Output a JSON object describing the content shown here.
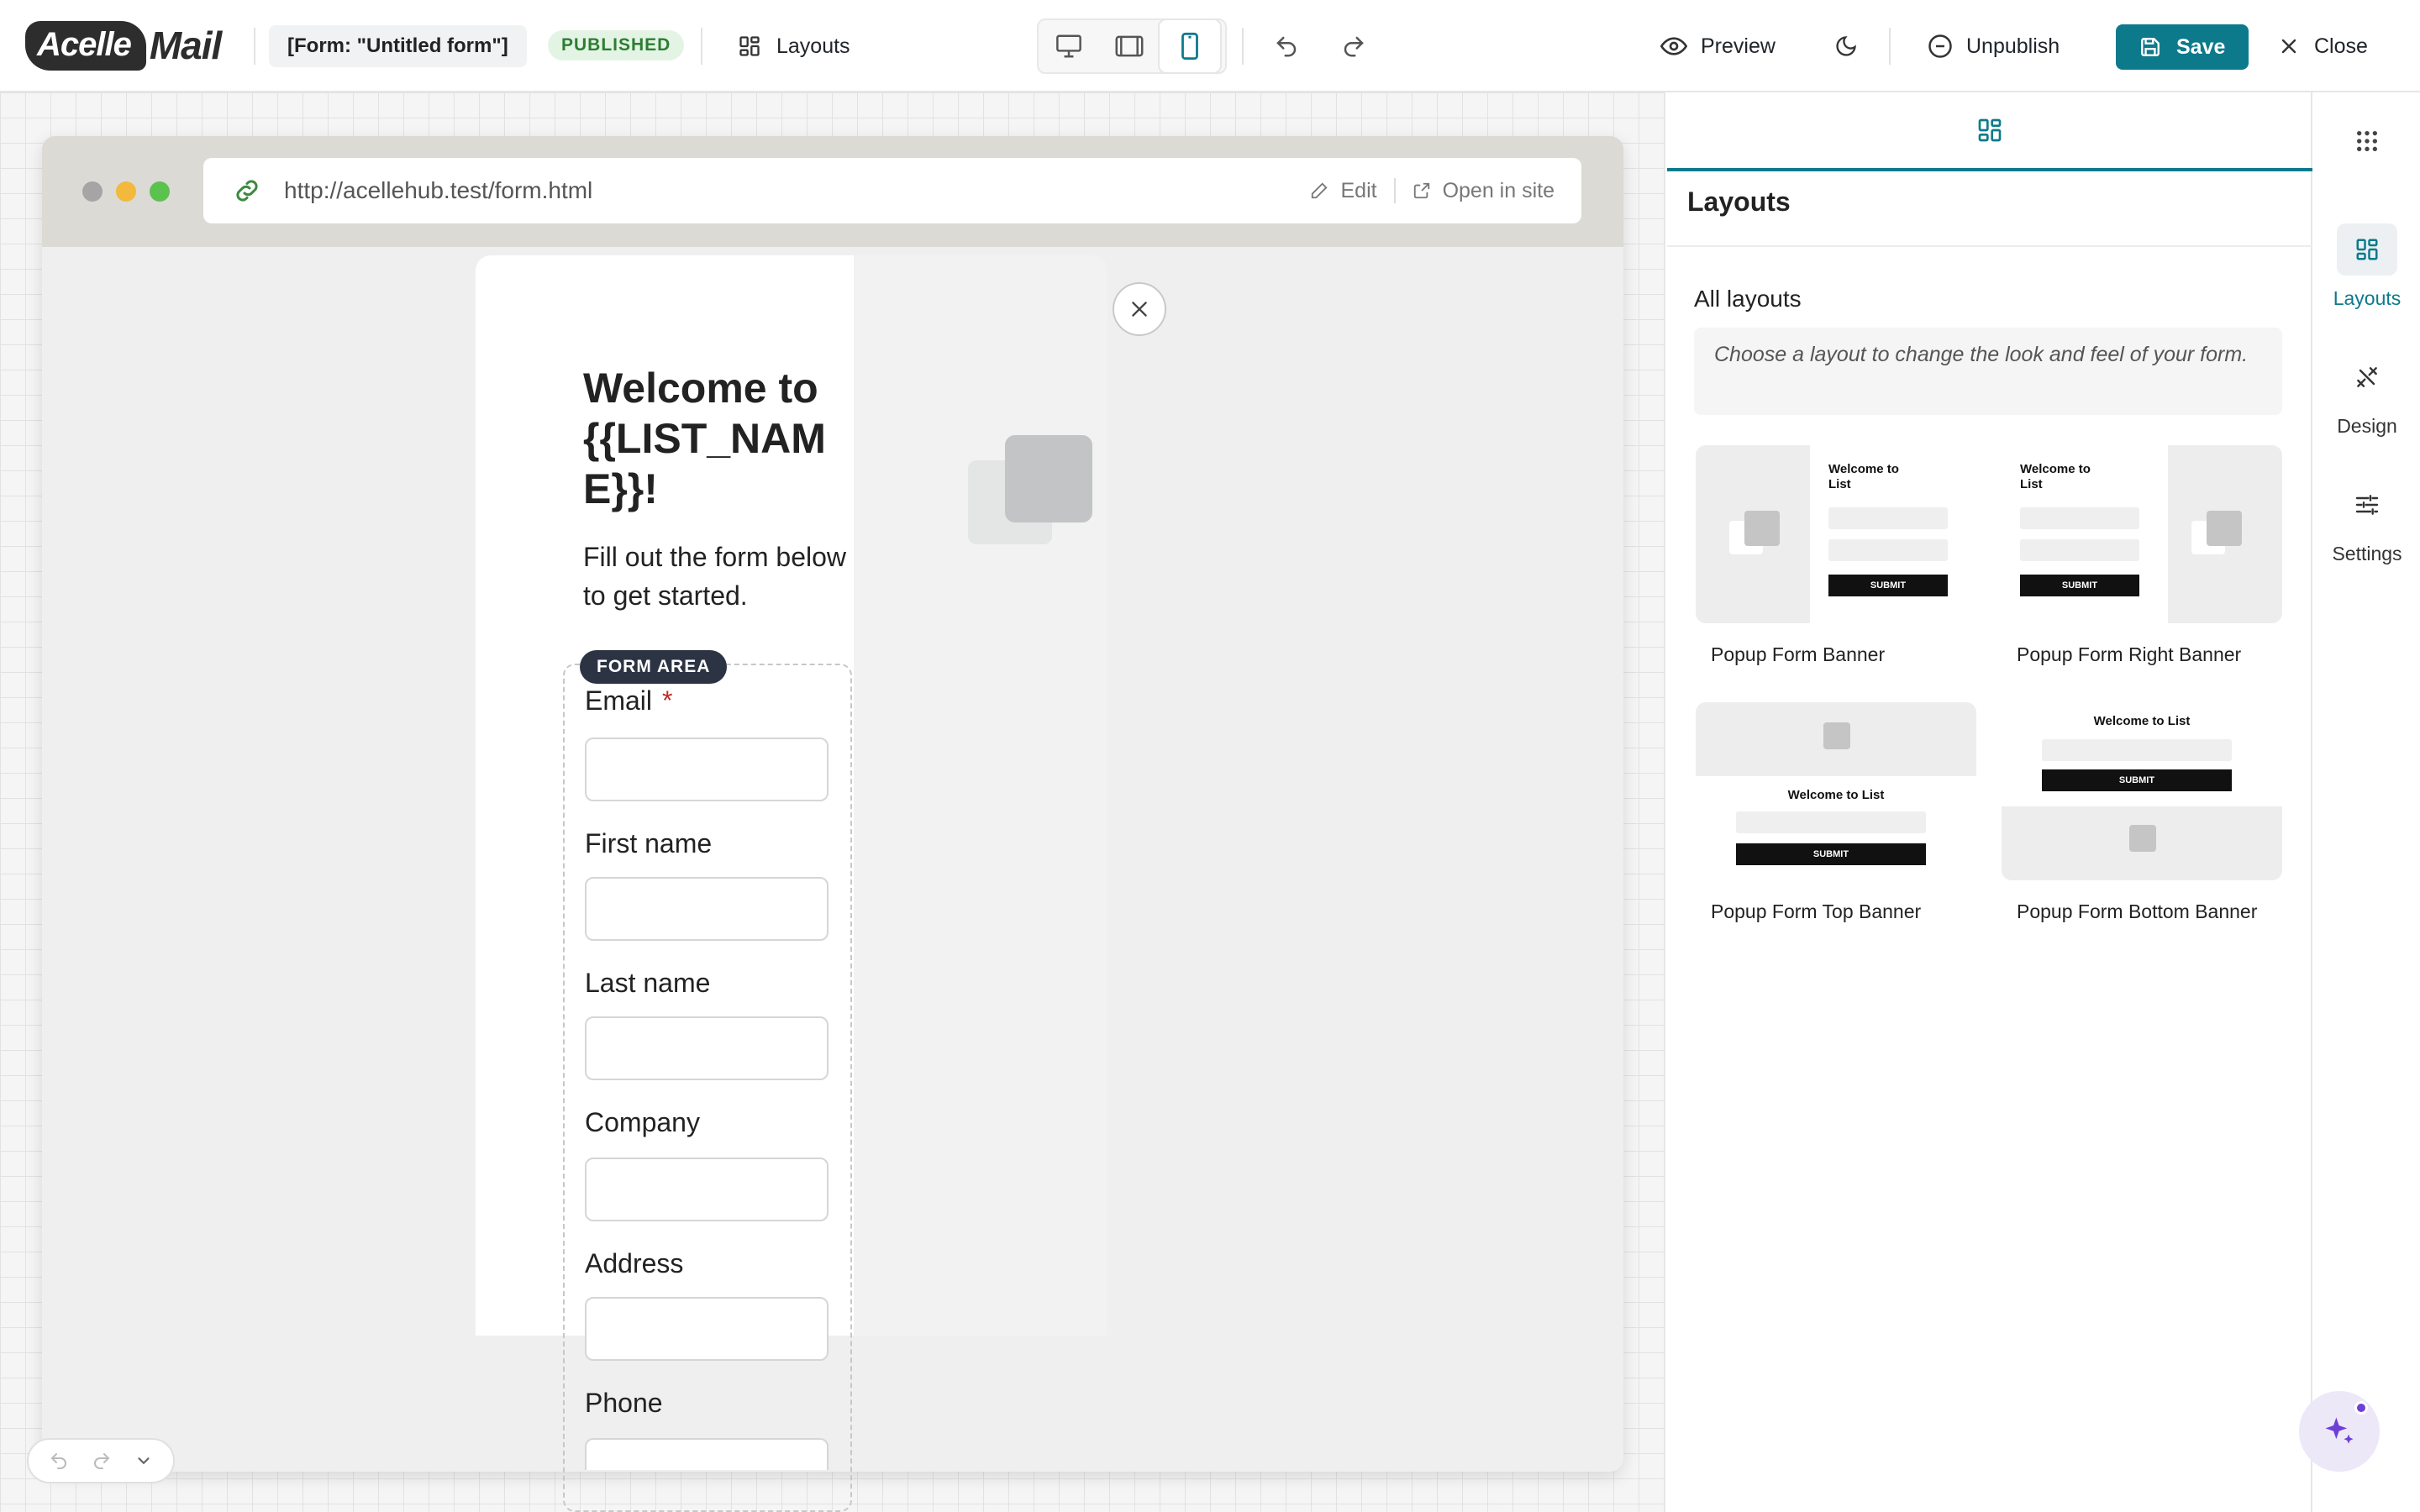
{
  "app": {
    "logo_left": "Acelle",
    "logo_right": "Mail"
  },
  "header": {
    "form_name": "[Form: \"Untitled form\"]",
    "status_badge": "PUBLISHED",
    "layouts_label": "Layouts",
    "device_modes": [
      "desktop",
      "tablet",
      "mobile"
    ],
    "active_device": "mobile",
    "preview_label": "Preview",
    "unpublish_label": "Unpublish",
    "save_label": "Save",
    "close_label": "Close"
  },
  "browser": {
    "url": "http://acellehub.test/form.html",
    "edit_label": "Edit",
    "open_label": "Open in site"
  },
  "popup": {
    "title": "Welcome to {{LIST_NAME}}!",
    "subtitle": "Fill out the form below to get started.",
    "form_area_tag": "FORM AREA",
    "fields": [
      {
        "label": "Email",
        "required": "*"
      },
      {
        "label": "First name"
      },
      {
        "label": "Last name"
      },
      {
        "label": "Company"
      },
      {
        "label": "Address"
      },
      {
        "label": "Phone"
      }
    ]
  },
  "panel": {
    "title": "Layouts",
    "section_title": "All layouts",
    "hint": "Choose a layout to change the look and feel of your form.",
    "layouts": [
      {
        "name": "Popup Form Banner",
        "preview_title": "Welcome to List",
        "submit": "SUBMIT"
      },
      {
        "name": "Popup Form Right Banner",
        "preview_title": "Welcome to List",
        "submit": "SUBMIT"
      },
      {
        "name": "Popup Form Top Banner",
        "preview_title": "Welcome to List",
        "submit": "SUBMIT"
      },
      {
        "name": "Popup Form Bottom Banner",
        "preview_title": "Welcome to List",
        "submit": "SUBMIT"
      }
    ]
  },
  "sidebar": {
    "items": [
      {
        "label": "Layouts",
        "icon": "layouts-icon",
        "active": true
      },
      {
        "label": "Design",
        "icon": "design-icon",
        "active": false
      },
      {
        "label": "Settings",
        "icon": "settings-icon",
        "active": false
      }
    ]
  },
  "colors": {
    "accent": "#0d7a8c",
    "published_bg": "#e3f4e5",
    "published_text": "#2e7d32",
    "form_area_tag": "#2c3444",
    "required": "#c62828",
    "ai_accent": "#6d3fd6"
  }
}
